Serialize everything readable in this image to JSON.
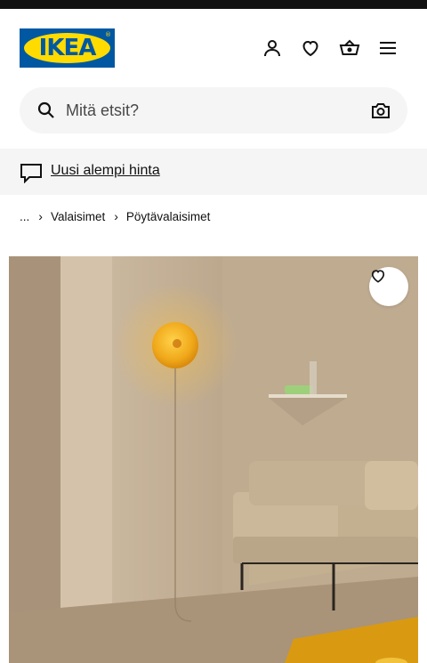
{
  "brand": {
    "logo_text": "IKEA"
  },
  "header": {
    "icons": [
      "account-icon",
      "heart-icon",
      "basket-icon",
      "menu-icon"
    ]
  },
  "search": {
    "placeholder": "Mitä etsit?",
    "value": ""
  },
  "banner": {
    "text": "Uusi alempi hinta"
  },
  "breadcrumb": {
    "items": [
      "...",
      "Valaisimet",
      "Pöytävalaisimet"
    ]
  },
  "colors": {
    "brand_blue": "#0058a3",
    "brand_yellow": "#ffdb00",
    "surface_gray": "#f5f5f5"
  }
}
